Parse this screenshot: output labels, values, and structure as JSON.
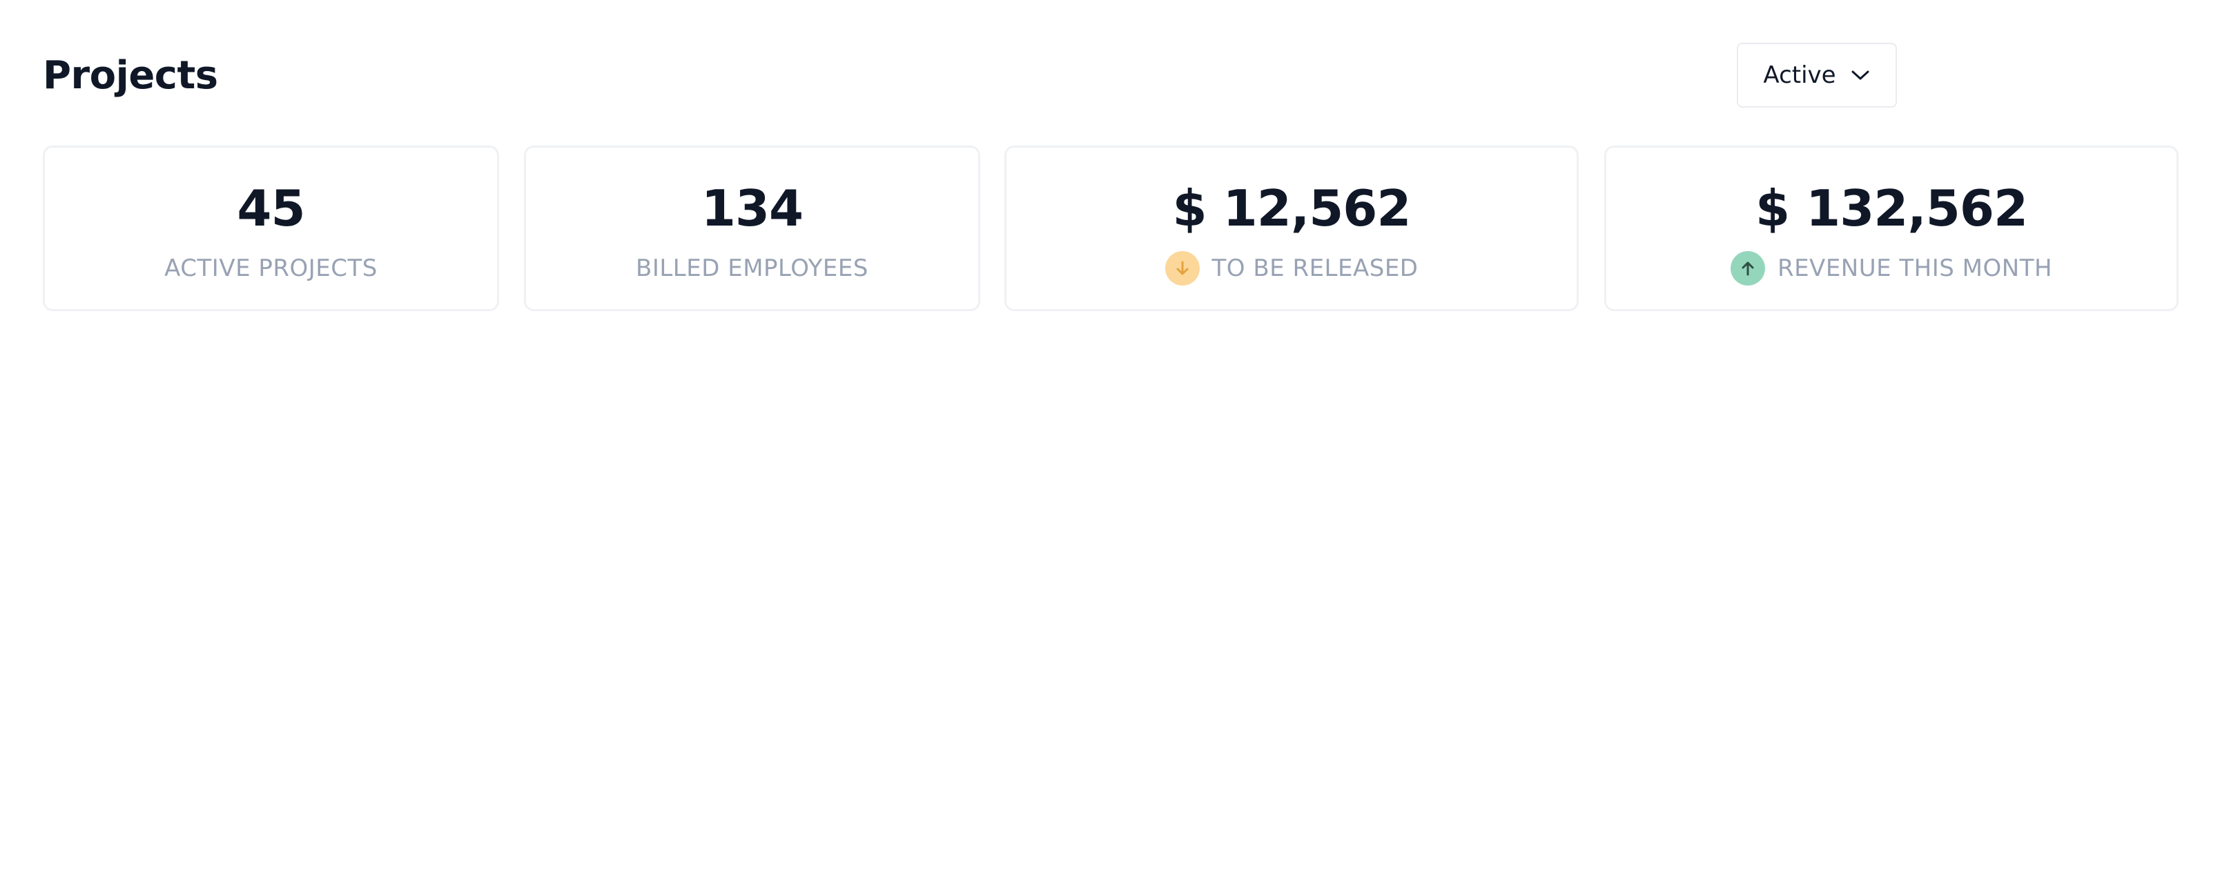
{
  "header": {
    "title": "Projects",
    "filter": {
      "selected": "Active"
    }
  },
  "stats": [
    {
      "value": "45",
      "label": "ACTIVE PROJECTS"
    },
    {
      "value": "134",
      "label": "BILLED EMPLOYEES"
    },
    {
      "value": "$ 12,562",
      "label": "TO BE RELEASED",
      "icon": "arrow-down-icon",
      "icon_bg": "#fcd79a",
      "icon_color": "#e6a23c"
    },
    {
      "value": "$ 132,562",
      "label": "REVENUE THIS MONTH",
      "icon": "arrow-up-icon",
      "icon_bg": "#94d6bc",
      "icon_color": "#2f4f44"
    }
  ],
  "colors": {
    "text_primary": "#101828",
    "text_muted": "#98a2b3",
    "card_border": "#eff1f4"
  }
}
